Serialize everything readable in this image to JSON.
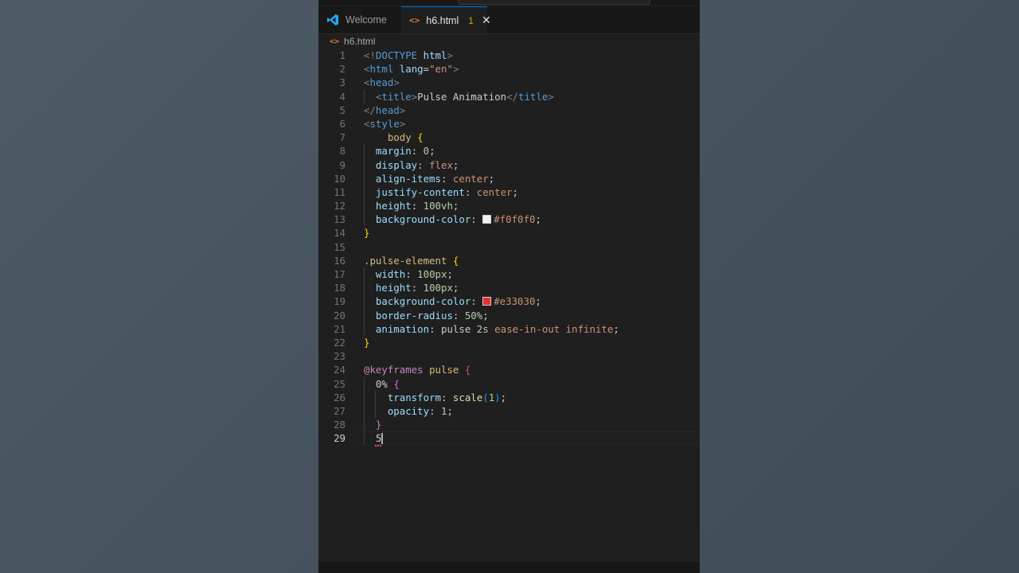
{
  "tabs": {
    "welcome": "Welcome",
    "active": "h6.html",
    "problems_count": "1",
    "close_symbol": "✕"
  },
  "breadcrumb": "h6.html",
  "icons": {
    "html_file": "<>",
    "vscode": "vscode-icon"
  },
  "colors": {
    "swatch_body": "#f0f0f0",
    "swatch_pulse": "#e33030",
    "editor_bg": "#1f1f1f",
    "accent": "#0078d4"
  },
  "code": {
    "current_line": 29,
    "lines": [
      {
        "n": "1",
        "text": "<!DOCTYPE html>"
      },
      {
        "n": "2",
        "text": "<html lang=\"en\">"
      },
      {
        "n": "3",
        "text": "<head>"
      },
      {
        "n": "4",
        "text": "  <title>Pulse Animation</title>"
      },
      {
        "n": "5",
        "text": "</head>"
      },
      {
        "n": "6",
        "text": "<style>"
      },
      {
        "n": "7",
        "text": "    body {"
      },
      {
        "n": "8",
        "text": "  margin: 0;"
      },
      {
        "n": "9",
        "text": "  display: flex;"
      },
      {
        "n": "10",
        "text": "  align-items: center;"
      },
      {
        "n": "11",
        "text": "  justify-content: center;"
      },
      {
        "n": "12",
        "text": "  height: 100vh;"
      },
      {
        "n": "13",
        "text": "  background-color: #f0f0f0;"
      },
      {
        "n": "14",
        "text": "}"
      },
      {
        "n": "15",
        "text": ""
      },
      {
        "n": "16",
        "text": ".pulse-element {"
      },
      {
        "n": "17",
        "text": "  width: 100px;"
      },
      {
        "n": "18",
        "text": "  height: 100px;"
      },
      {
        "n": "19",
        "text": "  background-color: #e33030;"
      },
      {
        "n": "20",
        "text": "  border-radius: 50%;"
      },
      {
        "n": "21",
        "text": "  animation: pulse 2s ease-in-out infinite;"
      },
      {
        "n": "22",
        "text": "}"
      },
      {
        "n": "23",
        "text": ""
      },
      {
        "n": "24",
        "text": "@keyframes pulse {"
      },
      {
        "n": "25",
        "text": "  0% {"
      },
      {
        "n": "26",
        "text": "    transform: scale(1);"
      },
      {
        "n": "27",
        "text": "    opacity: 1;"
      },
      {
        "n": "28",
        "text": "  }"
      },
      {
        "n": "29",
        "text": "  5"
      }
    ]
  }
}
